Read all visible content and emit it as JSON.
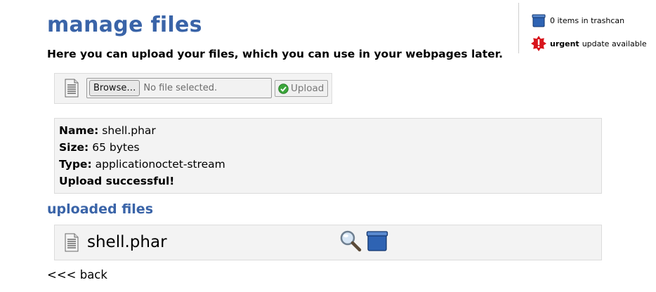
{
  "page": {
    "title": "manage files",
    "intro": "Here you can upload your files, which you can use in your webpages later."
  },
  "sidebar": {
    "trash_text": "0 items in trashcan",
    "trash_icon": "trashcan-icon",
    "update_strong": "urgent",
    "update_text": "update available",
    "update_icon": "warning-icon"
  },
  "upload": {
    "browse_label": "Browse…",
    "no_file_text": "No file selected.",
    "upload_label": "Upload",
    "file_icon": "document-icon",
    "upload_icon": "checkmark-icon"
  },
  "result": {
    "name_label": "Name:",
    "name_value": "shell.phar",
    "size_label": "Size:",
    "size_value": "65 bytes",
    "type_label": "Type:",
    "type_value": "applicationoctet-stream",
    "status": "Upload successful!"
  },
  "uploaded": {
    "heading": "uploaded files",
    "files": [
      {
        "name": "shell.phar",
        "icon": "document-icon",
        "actions": [
          "view-icon",
          "trashcan-icon"
        ]
      }
    ]
  },
  "nav": {
    "back": "<<< back"
  },
  "colors": {
    "heading": "#3a64a8",
    "panel": "#f3f3f3",
    "panel_border": "#dcdcdc",
    "trash": "#2e63b3",
    "warning": "#d8141c"
  }
}
